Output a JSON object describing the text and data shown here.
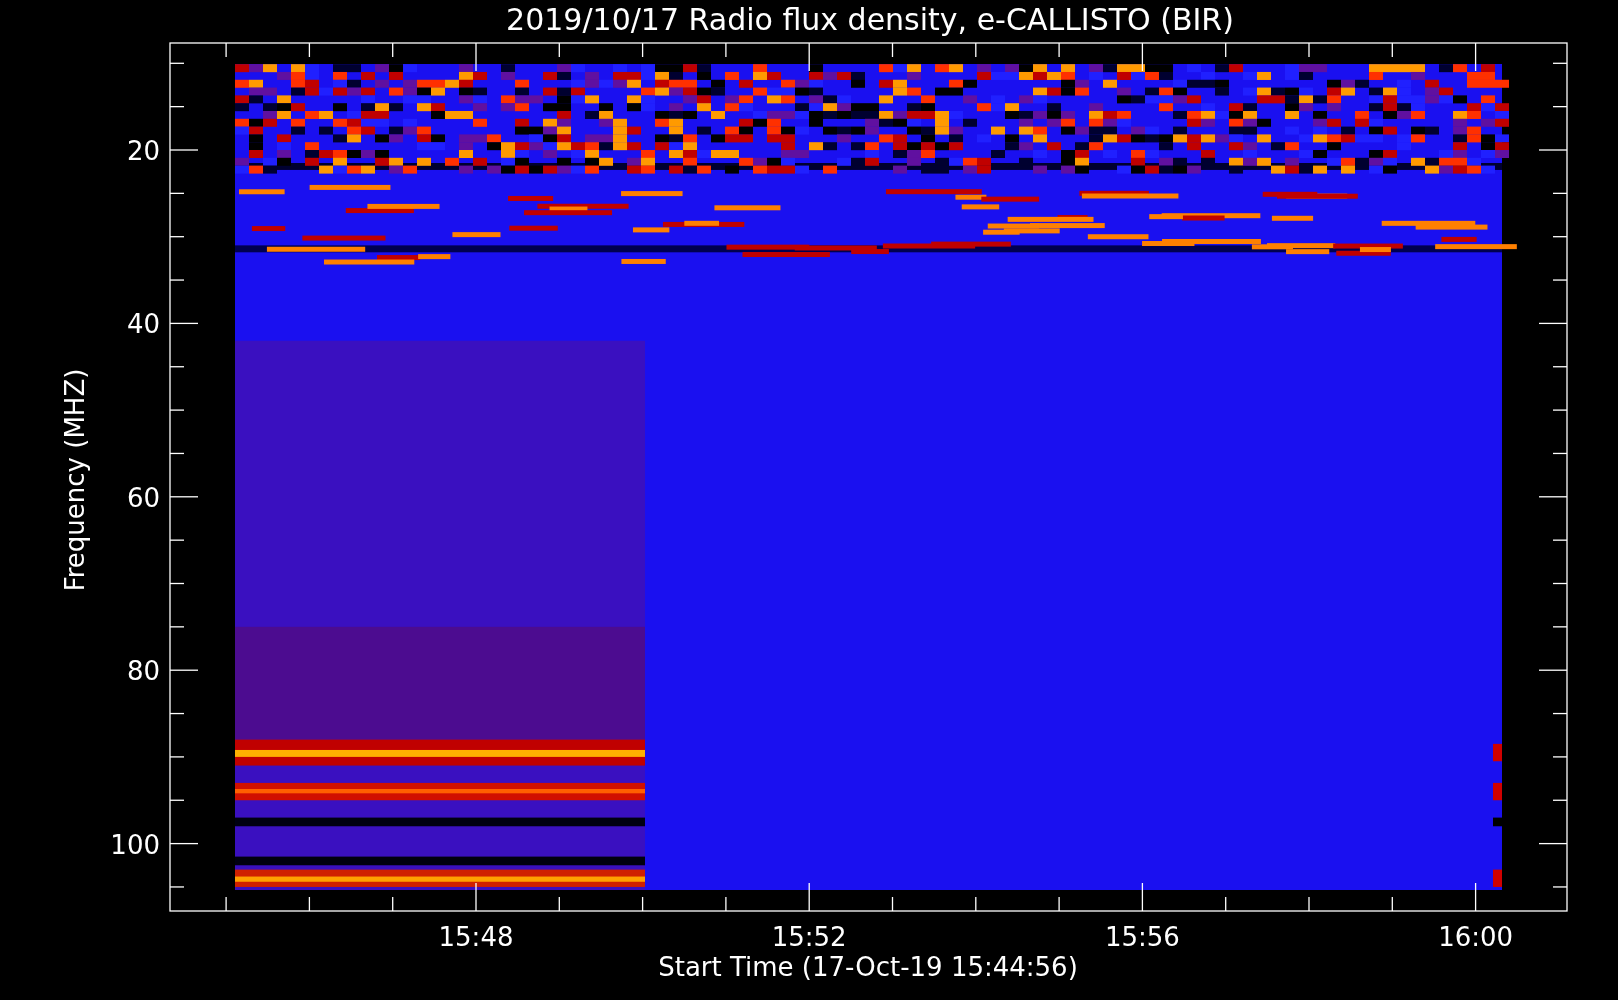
{
  "plot": {
    "title": "2019/10/17  Radio flux density, e-CALLISTO (BIR)",
    "ylabel": "Frequency (MHZ)",
    "xlabel": "Start Time (17-Oct-19 15:44:56)",
    "y_tick_labels": [
      "20",
      "40",
      "60",
      "80",
      "100"
    ],
    "x_tick_labels": [
      "15:48",
      "15:52",
      "15:56",
      "16:00"
    ]
  }
}
